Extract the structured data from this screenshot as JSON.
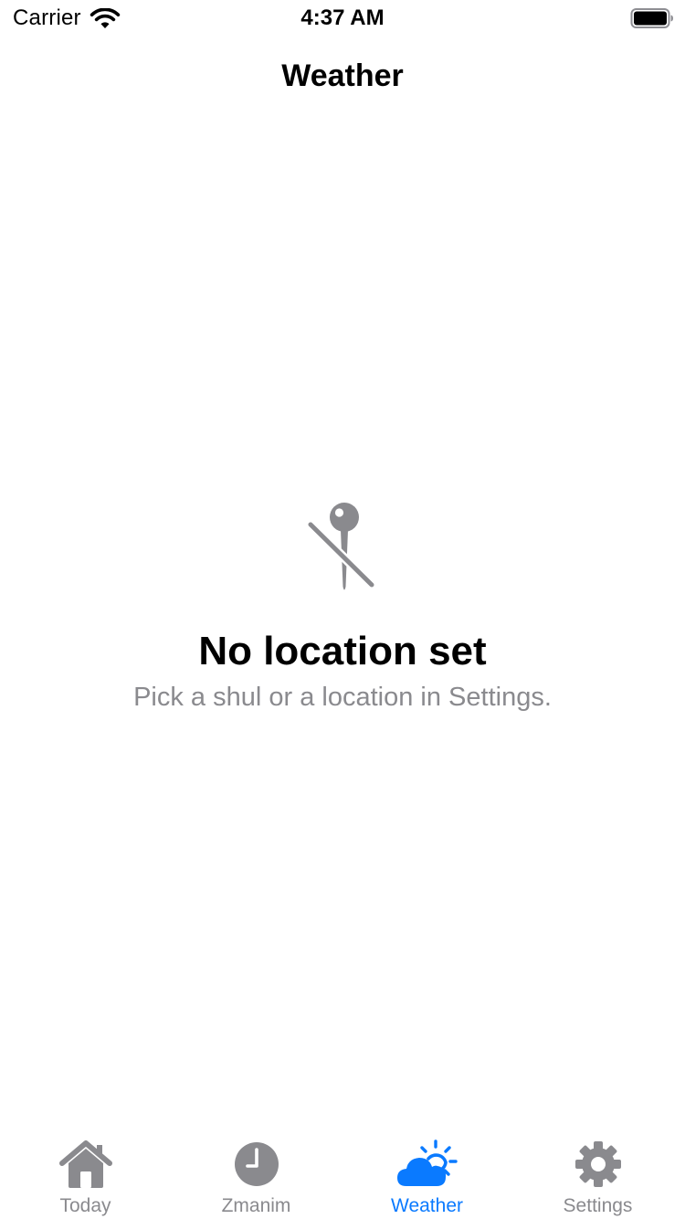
{
  "status_bar": {
    "carrier": "Carrier",
    "time": "4:37 AM"
  },
  "nav": {
    "title": "Weather"
  },
  "empty_state": {
    "icon": "location-slash-icon",
    "title": "No location set",
    "subtitle": "Pick a shul or a location in Settings."
  },
  "tab_bar": {
    "active_color": "#0a7aff",
    "inactive_color": "#8a8a8e",
    "tabs": [
      {
        "label": "Today",
        "icon": "house-icon",
        "active": false
      },
      {
        "label": "Zmanim",
        "icon": "clock-icon",
        "active": false
      },
      {
        "label": "Weather",
        "icon": "cloud-sun-icon",
        "active": true
      },
      {
        "label": "Settings",
        "icon": "gear-icon",
        "active": false
      }
    ]
  }
}
